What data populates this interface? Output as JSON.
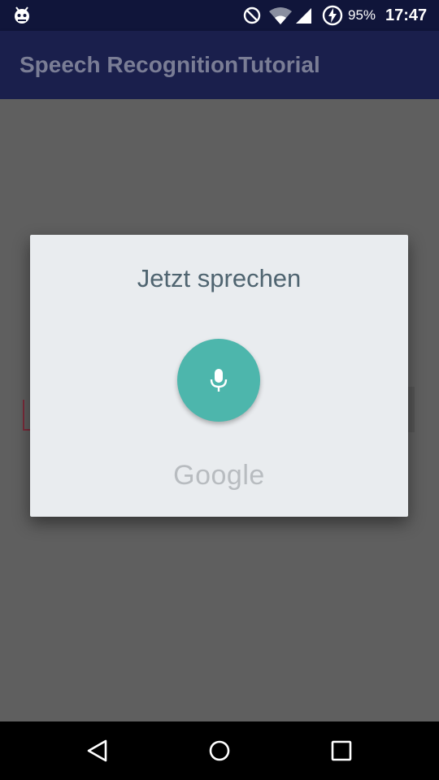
{
  "status_bar": {
    "battery_percent": "95%",
    "time": "17:47",
    "icons": [
      "android-debug-icon",
      "do-not-disturb-icon",
      "wifi-icon",
      "cell-signal-icon",
      "battery-charging-icon"
    ]
  },
  "app_bar": {
    "title": "Speech RecognitionTutorial"
  },
  "dialog": {
    "prompt": "Jetzt sprechen",
    "mic_icon": "microphone-icon",
    "brand": "Google"
  },
  "nav_bar": {
    "icons": [
      "back-icon",
      "home-icon",
      "recents-icon"
    ]
  },
  "colors": {
    "status_bar": "#10153a",
    "app_bar_dimmed": "#1a1f4c",
    "scrim_background": "#5f5f5f",
    "dialog_background": "#e9ecef",
    "mic_button": "#4db6ac",
    "prompt_text": "#4f6470"
  }
}
